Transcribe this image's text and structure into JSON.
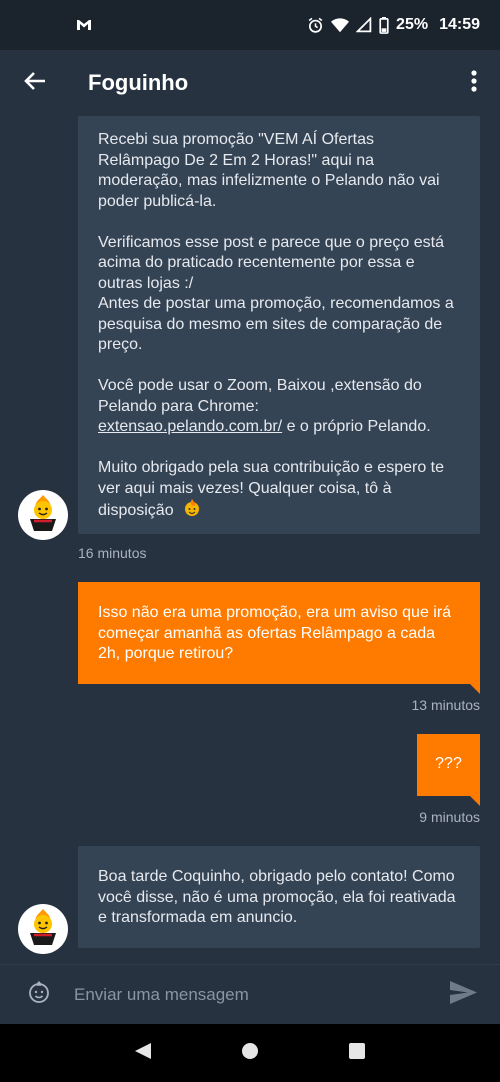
{
  "status_bar": {
    "battery": "25%",
    "time": "14:59",
    "icons": [
      "gmail-icon",
      "alarm-icon",
      "wifi-icon",
      "signal-icon",
      "battery-icon"
    ]
  },
  "header": {
    "title": "Foguinho",
    "icons": [
      "back-arrow-icon",
      "more-vert-icon"
    ]
  },
  "messages": [
    {
      "direction": "incoming",
      "paragraphs": [
        "Recebi sua promoção  \"VEM AÍ Ofertas Relâmpago De 2 Em 2 Horas!\" aqui na moderação, mas infelizmente o Pelando não vai poder publicá-la.",
        "Verificamos esse post e parece que o preço está acima do praticado recentemente por essa e outras lojas :/",
        "Antes de postar uma promoção, recomendamos a pesquisa do mesmo em sites de comparação de preço.",
        "Você pode usar o Zoom, Baixou ,extensão do Pelando para Chrome:",
        "Muito obrigado pela sua contribuição e espero te ver aqui mais vezes! Qualquer coisa, tô à disposição"
      ],
      "link_text": "extensao.pelando.com.br/",
      "link_suffix": " e o próprio Pelando.",
      "time": "16 minutos"
    },
    {
      "direction": "outgoing",
      "text": "Isso não era uma promoção, era um aviso que irá começar amanhã as ofertas Relâmpago a cada 2h, porque retirou?",
      "time": "13 minutos"
    },
    {
      "direction": "outgoing",
      "text": "???",
      "time": "9 minutos"
    },
    {
      "direction": "incoming",
      "text": "Boa tarde Coquinho, obrigado pelo contato! Como você disse, não é uma promoção, ela foi reativada e transformada em anuncio."
    }
  ],
  "composer": {
    "placeholder": "Enviar uma mensagem",
    "value": "",
    "icons": [
      "emoji-icon",
      "send-icon"
    ]
  },
  "nav_bar": {
    "icons": [
      "nav-back-icon",
      "nav-home-icon",
      "nav-recents-icon"
    ]
  },
  "colors": {
    "background": "#263240",
    "incoming_bubble": "#354455",
    "outgoing_bubble": "#ff7b00",
    "status_bar": "#1b232c"
  }
}
